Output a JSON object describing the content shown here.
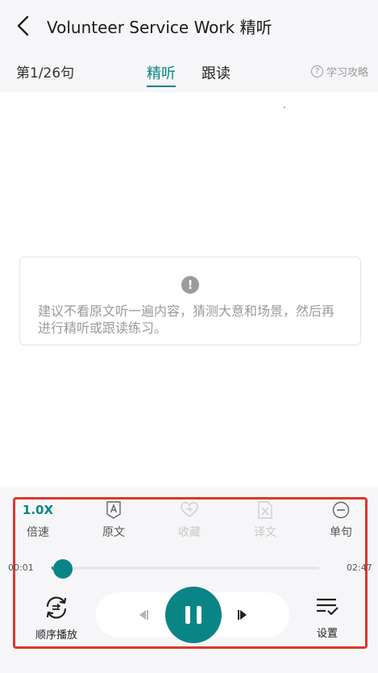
{
  "header": {
    "title": "Volunteer Service Work 精听",
    "counter": "第1/26句",
    "tabs": [
      "精听",
      "跟读"
    ],
    "active_tab": "精听",
    "guide": "学习攻略"
  },
  "tip": {
    "text": "建议不看原文听一遍内容，猜测大意和场景，然后再进行精听或跟读练习。"
  },
  "toolbar": {
    "speed_value": "1.0X",
    "speed_label": "倍速",
    "original_label": "原文",
    "favorite_label": "收藏",
    "translation_label": "译文",
    "sentence_label": "单句"
  },
  "player": {
    "current_time": "00:01",
    "total_time": "02:47",
    "progress": 0.006,
    "mode_label": "顺序播放",
    "settings_label": "设置",
    "state": "playing"
  },
  "colors": {
    "accent": "#0a8585",
    "highlight_frame": "#d9392b",
    "panel_bg": "#f6f6f9"
  },
  "icons": {
    "back": "chevron-left-icon",
    "guide": "question-circle-icon",
    "alert": "exclamation-circle-icon",
    "original": "letter-a-icon",
    "favorite": "heart-icon",
    "translation": "translate-doc-icon",
    "sentence": "minus-circle-icon",
    "mode": "sequential-loop-icon",
    "settings": "list-check-icon",
    "prev": "previous-icon",
    "next": "next-icon",
    "pause": "pause-icon"
  }
}
